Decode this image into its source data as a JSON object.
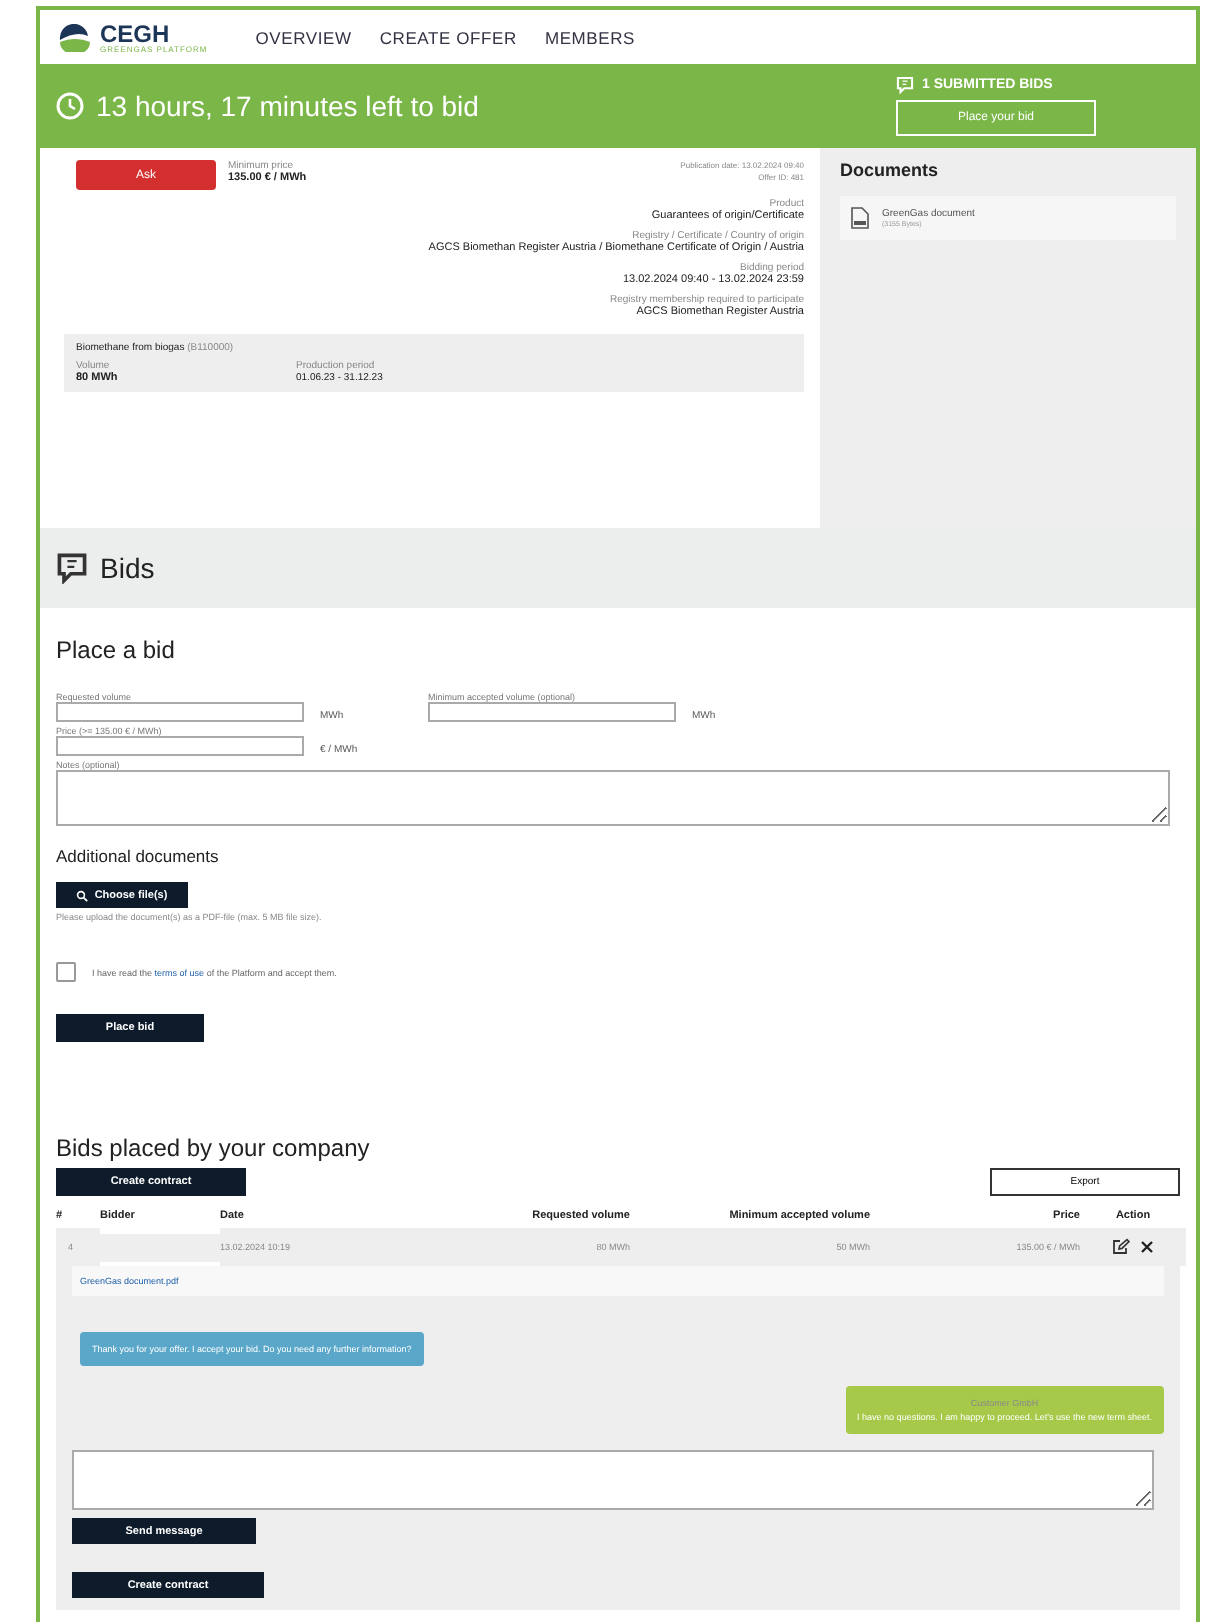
{
  "nav": {
    "logo": "CEGH",
    "logo_sub": "GREENGAS PLATFORM",
    "items": [
      "OVERVIEW",
      "CREATE OFFER",
      "MEMBERS"
    ]
  },
  "banner": {
    "time_left": "13 hours, 17 minutes left to bid",
    "submitted": "1 SUBMITTED BIDS",
    "button": "Place your bid"
  },
  "offer": {
    "type": "Ask",
    "price_label": "Minimum price",
    "price": "135.00 € / MWh",
    "meta": [
      "Publication date: 13.02.2024 09:40",
      "Offer ID: 481"
    ],
    "fields": [
      {
        "label": "Product",
        "value": "Guarantees of origin/Certificate"
      },
      {
        "label": "Registry / Certificate / Country of origin",
        "value": "AGCS Biomethan Register Austria / Biomethane Certificate of Origin / Austria"
      },
      {
        "label": "Bidding period",
        "value": "13.02.2024 09:40 - 13.02.2024 23:59"
      },
      {
        "label": "Registry membership required to participate",
        "value": "AGCS Biomethan Register Austria"
      }
    ],
    "product_title": "Biomethane from biogas",
    "product_code": "(B110000)",
    "volume_label": "Volume",
    "volume": "80 MWh",
    "period_label": "Production period",
    "period": "01.06.23 - 31.12.23"
  },
  "documents": {
    "title": "Documents",
    "items": [
      {
        "name": "GreenGas document",
        "size": "(3155 Bytes)"
      }
    ]
  },
  "bids_title": "Bids",
  "form": {
    "title": "Place a bid",
    "requested_label": "Requested volume",
    "requested_unit": "MWh",
    "min_label": "Minimum accepted volume (optional)",
    "min_unit": "MWh",
    "price_label": "Price (>= 135.00 € / MWh)",
    "price_unit": "€ / MWh",
    "notes_label": "Notes (optional)",
    "docs_title": "Additional documents",
    "choose": "Choose file(s)",
    "upload_hint": "Please upload the document(s) as a PDF-file (max. 5 MB file size).",
    "terms_before": "I have read the",
    "terms_link": "terms of use",
    "terms_after": "of the Platform and accept them.",
    "terms_checked": false,
    "submit": "Place bid"
  },
  "company_bids": {
    "title": "Bids placed by your company",
    "create": "Create contract",
    "export": "Export",
    "columns": [
      "#",
      "Bidder",
      "Date",
      "Requested volume",
      "Minimum accepted volume",
      "Price",
      "Action"
    ],
    "rows": [
      {
        "index": "4",
        "date": "13.02.2024 10:19",
        "requested": "80 MWh",
        "minimum": "50 MWh",
        "price": "135.00 € / MWh",
        "expanded": true
      }
    ],
    "attachment": "GreenGas document.pdf",
    "messages": [
      {
        "kind": "received",
        "text": "Thank you for your offer. I accept your bid. Do you need any further information?"
      },
      {
        "kind": "sent",
        "author": "Customer GmbH",
        "text": "I have no questions. I am happy to proceed. Let's use the new term sheet."
      }
    ],
    "send": "Send message",
    "create_bottom": "Create contract"
  }
}
